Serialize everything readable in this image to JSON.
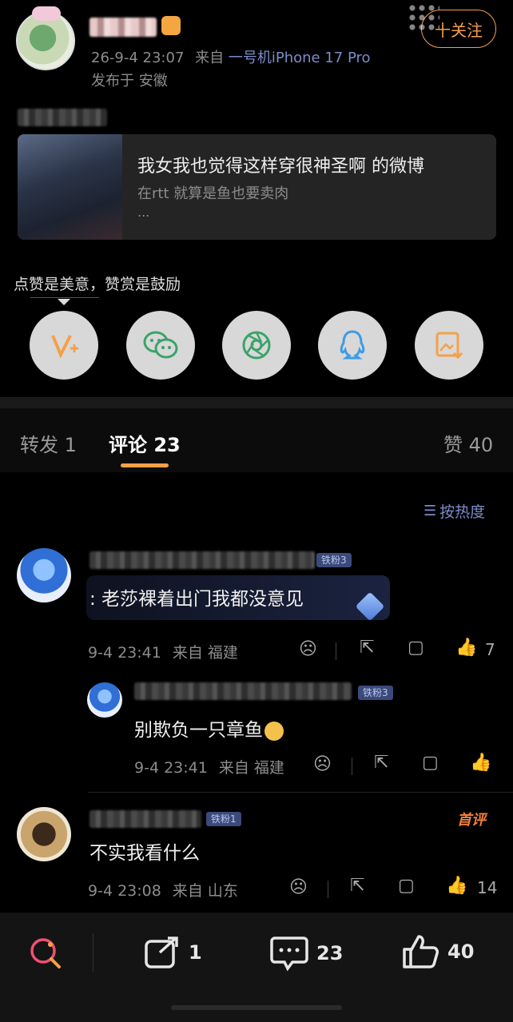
{
  "post": {
    "date": "26-9-4 23:07",
    "source_prefix": "来自",
    "source_device": "一号机iPhone 17 Pro",
    "location": "发布于 安徽",
    "follow_label": "十关注"
  },
  "quote_card": {
    "title": "我女我也觉得这样穿很神圣啊 的微博",
    "line1": "在rtt 就算是鱼也要卖肉",
    "line2": "..."
  },
  "reward_hint": "点赞是美意，赞赏是鼓励",
  "share_icons": [
    "reward-v-icon",
    "wechat-icon",
    "moments-icon",
    "qq-icon",
    "save-image-icon"
  ],
  "tabs": {
    "repost": "转发 1",
    "comments": "评论 23",
    "likes": "赞 40"
  },
  "sort_label": "按热度",
  "comments": [
    {
      "fan_badge": "铁粉3",
      "text": ": 老莎裸着出门我都没意见",
      "time": "9-4 23:41",
      "source": "来自 福建",
      "likes": "7"
    },
    {
      "fan_badge": "铁粉3",
      "text": "别欺负一只章鱼",
      "time": "9-4 23:41",
      "source": "来自 福建",
      "likes": ""
    },
    {
      "fan_badge": "铁粉1",
      "top_badge": "首评",
      "text": "不实我看什么",
      "time": "9-4 23:08",
      "source": "来自 山东",
      "likes": "14"
    }
  ],
  "bottom_bar": {
    "reposts": "1",
    "comments": "23",
    "likes": "40"
  },
  "colors": {
    "accent_orange": "#f5a04a",
    "link_blue": "#7c8cc9",
    "tab_underline": "#f5a04a"
  }
}
